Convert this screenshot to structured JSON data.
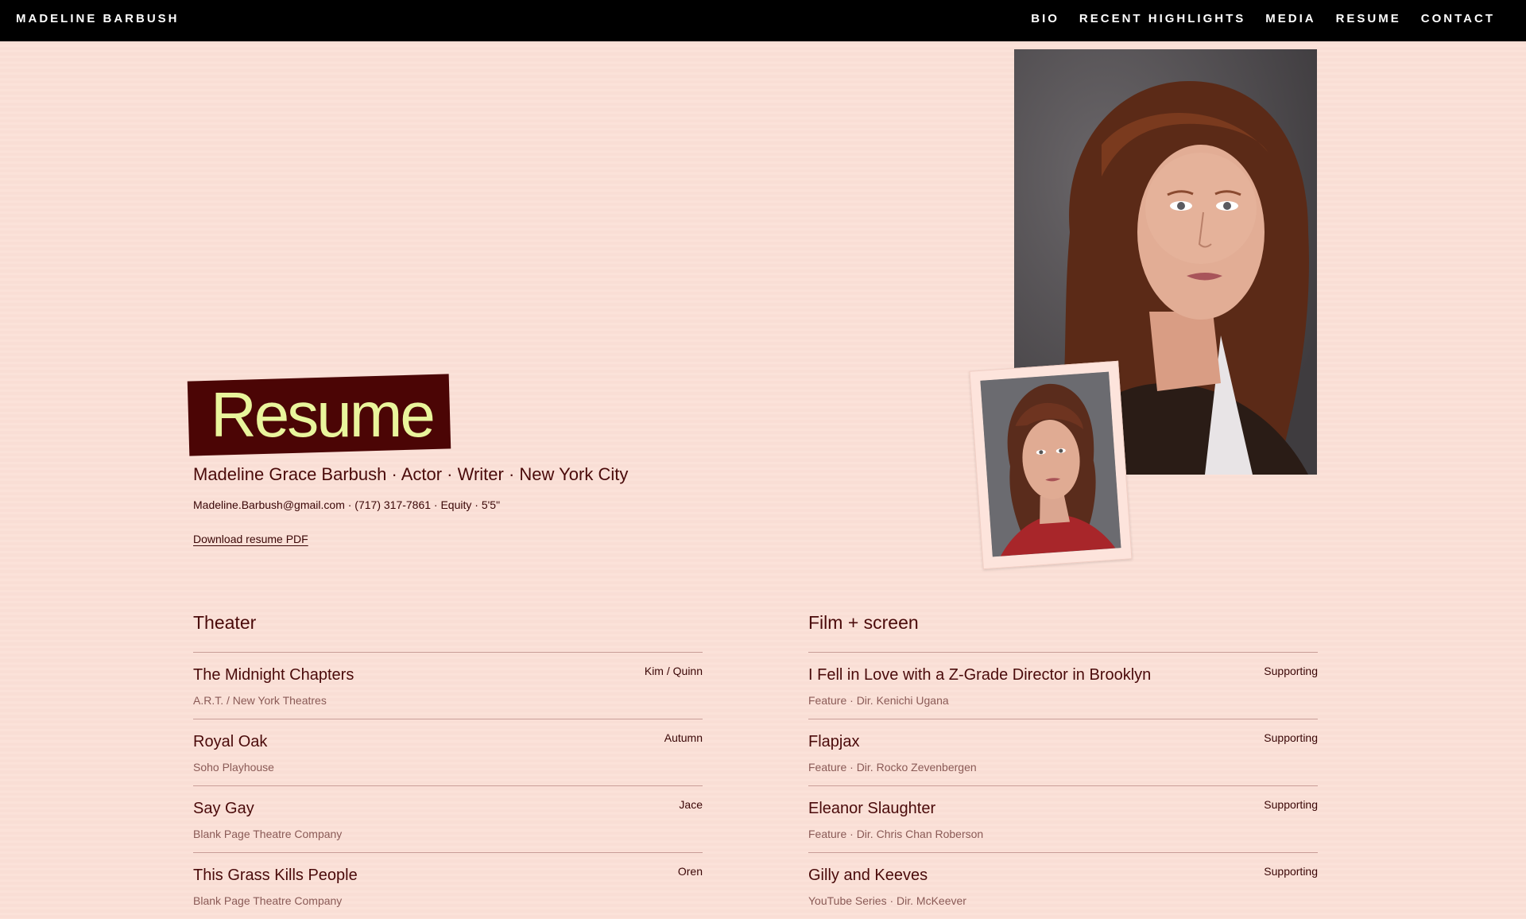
{
  "header": {
    "brand": "MADELINE BARBUSH",
    "nav": [
      "BIO",
      "RECENT HIGHLIGHTS",
      "MEDIA",
      "RESUME",
      "CONTACT"
    ]
  },
  "hero": {
    "title": "Resume",
    "subtitle": "Madeline Grace Barbush · Actor · Writer · New York City",
    "contact": "Madeline.Barbush@gmail.com · (717) 317-7861 · Equity · 5'5\"",
    "download_label": "Download resume PDF"
  },
  "theater": {
    "heading": "Theater",
    "entries": [
      {
        "title": "The Midnight Chapters",
        "detail": "A.R.T. / New York Theatres",
        "role": "Kim / Quinn"
      },
      {
        "title": "Royal Oak",
        "detail": "Soho Playhouse",
        "role": "Autumn"
      },
      {
        "title": "Say Gay",
        "detail": "Blank Page Theatre Company",
        "role": "Jace"
      },
      {
        "title": "This Grass Kills People",
        "detail": "Blank Page Theatre Company",
        "role": "Oren"
      }
    ]
  },
  "film": {
    "heading": "Film + screen",
    "entries": [
      {
        "title": "I Fell in Love with a Z-Grade Director in Brooklyn",
        "detail": "Feature · Dir. Kenichi Ugana",
        "role": "Supporting"
      },
      {
        "title": "Flapjax",
        "detail": "Feature · Dir. Rocko Zevenbergen",
        "role": "Supporting"
      },
      {
        "title": "Eleanor Slaughter",
        "detail": "Feature · Dir. Chris Chan Roberson",
        "role": "Supporting"
      },
      {
        "title": "Gilly and Keeves",
        "detail": "YouTube Series · Dir. McKeever",
        "role": "Supporting"
      }
    ]
  },
  "colors": {
    "background": "#fbe0d7",
    "topbar": "#000000",
    "accent_dark": "#4b0505",
    "title_yellow": "#e9f59c",
    "text": "#4a0a0a"
  }
}
